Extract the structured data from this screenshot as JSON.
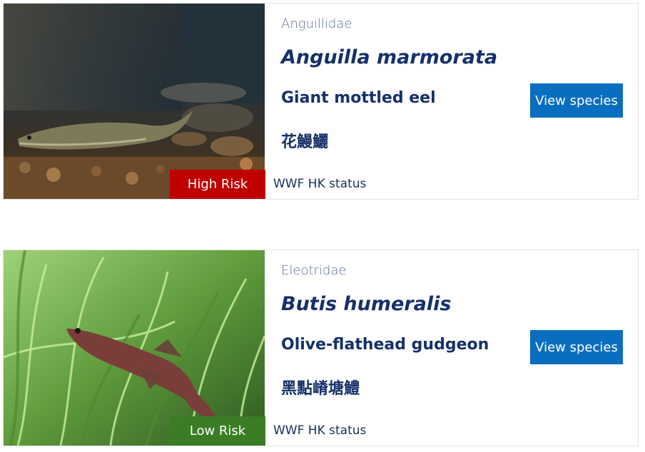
{
  "colors": {
    "high_risk": "#c00000",
    "low_risk": "#3a7d24",
    "button": "#0a6ec0",
    "title": "#16306a",
    "family": "#5b6f8f"
  },
  "species": [
    {
      "family": "Anguillidae",
      "scientific_name": "Anguilla marmorata",
      "common_name": "Giant mottled eel",
      "chinese_name": "花鰻鱺",
      "button_label": "View species",
      "risk": "High Risk",
      "risk_color": "#c00000",
      "status_label": "WWF HK status",
      "photo": "eel-photo"
    },
    {
      "family": "Eleotridae",
      "scientific_name": "Butis humeralis",
      "common_name": "Olive-flathead gudgeon",
      "chinese_name": "黑點嵴塘鱧",
      "button_label": "View species",
      "risk": "Low Risk",
      "risk_color": "#3a7d24",
      "status_label": "WWF HK status",
      "photo": "gudgeon-photo"
    }
  ]
}
